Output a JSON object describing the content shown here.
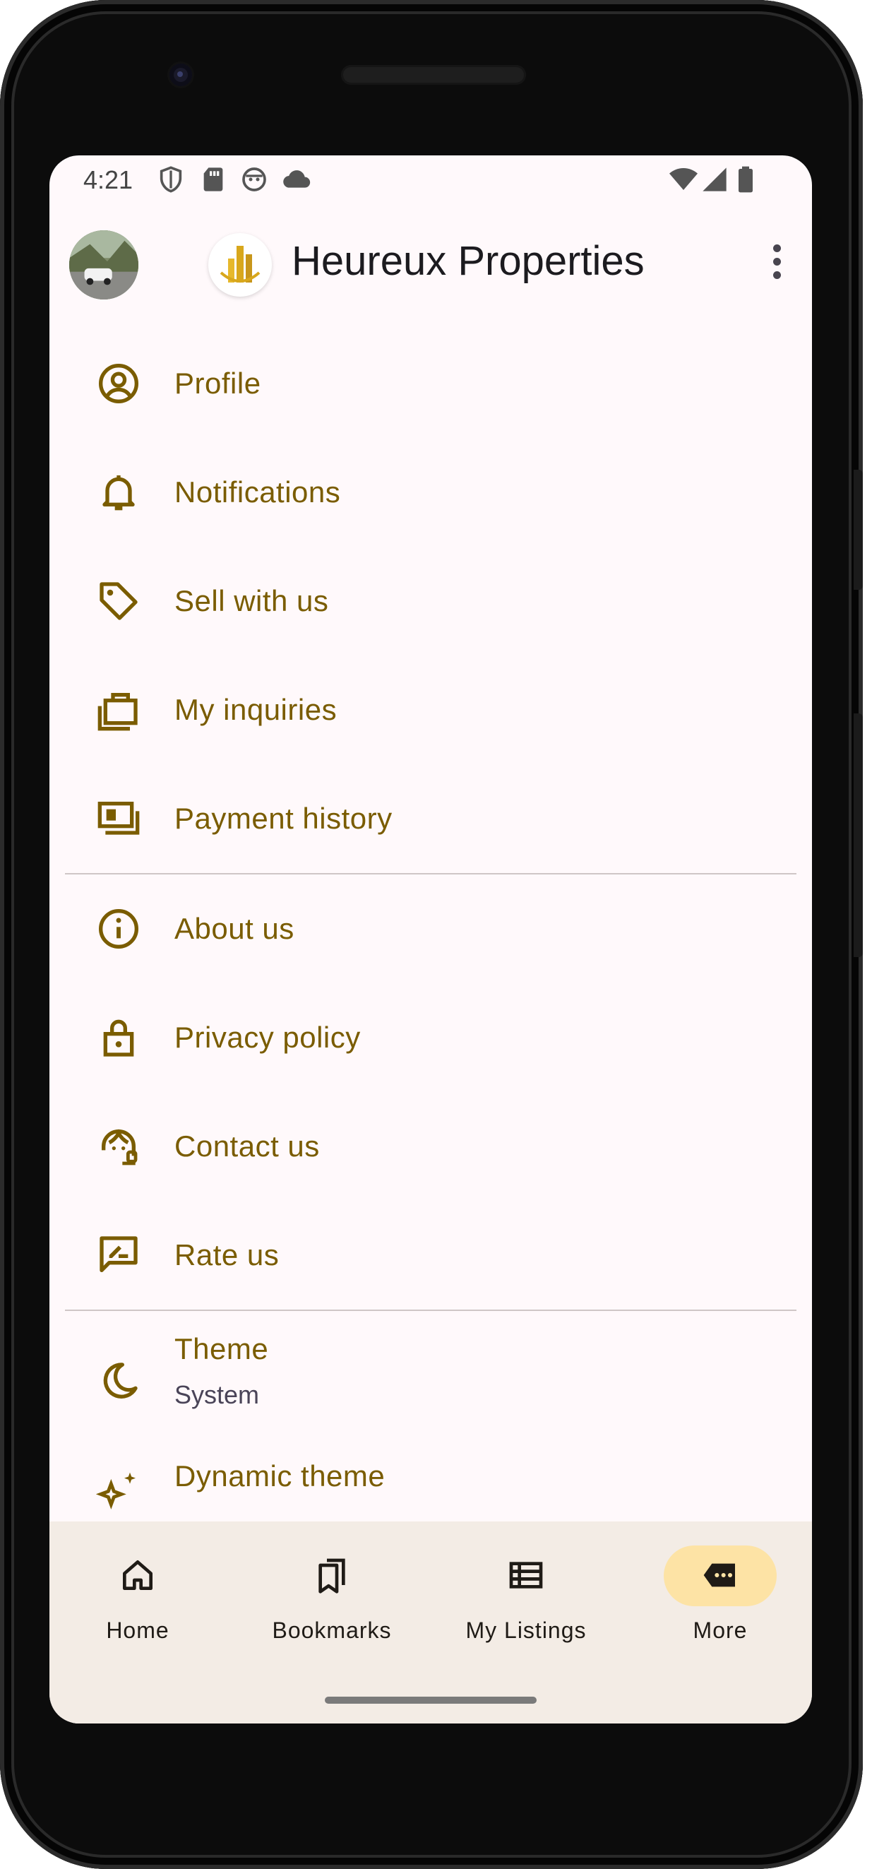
{
  "status_bar": {
    "time": "4:21",
    "left_icons": [
      "shield-icon",
      "sd-card-icon",
      "android-face-icon",
      "cloud-icon"
    ],
    "right_icons": [
      "wifi-icon",
      "signal-icon",
      "battery-icon"
    ]
  },
  "header": {
    "title": "Heureux Properties",
    "avatar": "profile-photo-car",
    "logo": "heureux-logo",
    "overflow_icon": "more-vert-icon"
  },
  "menu": {
    "section1": [
      {
        "label": "Profile",
        "icon": "account-circle-icon"
      },
      {
        "label": "Notifications",
        "icon": "bell-icon"
      },
      {
        "label": "Sell with us",
        "icon": "tag-icon"
      },
      {
        "label": "My inquiries",
        "icon": "briefcase-icon"
      },
      {
        "label": "Payment history",
        "icon": "payments-icon"
      }
    ],
    "section2": [
      {
        "label": "About us",
        "icon": "info-icon"
      },
      {
        "label": "Privacy policy",
        "icon": "lock-icon"
      },
      {
        "label": "Contact us",
        "icon": "support-agent-icon"
      },
      {
        "label": "Rate us",
        "icon": "rate-review-icon"
      }
    ],
    "section3": [
      {
        "label": "Theme",
        "sublabel": "System",
        "icon": "moon-icon"
      },
      {
        "label": "Dynamic theme",
        "icon": "sparkle-icon"
      }
    ]
  },
  "bottom_nav": {
    "items": [
      {
        "label": "Home",
        "icon": "home-icon"
      },
      {
        "label": "Bookmarks",
        "icon": "bookmarks-icon"
      },
      {
        "label": "My Listings",
        "icon": "list-icon"
      },
      {
        "label": "More",
        "icon": "more-chat-icon",
        "selected": true
      }
    ]
  },
  "colors": {
    "accent": "#7a5c00",
    "nav_active": "#fde3a5",
    "nav_bg": "#f3ece5",
    "surface": "#fff9fb"
  }
}
